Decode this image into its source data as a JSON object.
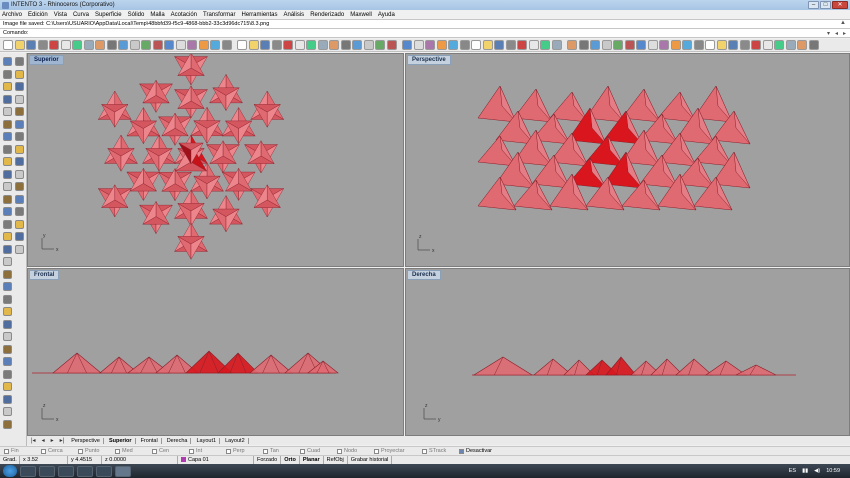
{
  "window": {
    "title": "INTENTO 3 - Rhinoceros (Corporativo)"
  },
  "menu": [
    "Archivo",
    "Edición",
    "Vista",
    "Curva",
    "Superficie",
    "Sólido",
    "Malla",
    "Acotación",
    "Transformar",
    "Herramientas",
    "Análisis",
    "Renderizado",
    "Maxwell",
    "Ayuda"
  ],
  "command_history": {
    "text": "Image file saved: C:\\Users\\USUARIO\\AppData\\Local\\Temp\\48bbfd39-f5c9-4868-bbb2-33c3d96dc715\\8.3.png"
  },
  "command_prompt": {
    "label": "Comando:"
  },
  "viewports": {
    "top": {
      "label": "Superior",
      "axis_x": "x",
      "axis_y": "y"
    },
    "perspective": {
      "label": "Perspective",
      "axis_x": "x",
      "axis_y": "y",
      "axis_z": "z"
    },
    "front": {
      "label": "Frontal",
      "axis_x": "x",
      "axis_y": "z"
    },
    "right": {
      "label": "Derecha",
      "axis_x": "y",
      "axis_y": "z"
    }
  },
  "view_tabs": [
    "Perspective",
    "Superior",
    "Frontal",
    "Derecha",
    "Layout1",
    "Layout2"
  ],
  "active_view_tab": "Superior",
  "osnaps": [
    "Fin",
    "Cerca",
    "Punto",
    "Med",
    "Cen",
    "Int",
    "Perp",
    "Tan",
    "Cuad",
    "Nodo",
    "Proyectar",
    "STrack",
    "Desactivar"
  ],
  "status": {
    "left_cell": "Grad.",
    "x": "x 3.52",
    "y": "y 4.4515",
    "z": "z 0.0000",
    "layer": "Capa 01",
    "modes": [
      "Forzado",
      "Orto",
      "Planar",
      "RefObj",
      "Grabar historial"
    ]
  },
  "tray": {
    "lang": "ES",
    "time": "10:59"
  },
  "colors": {
    "geometry": "#e06a72",
    "geometry_edge": "#8a1f2a",
    "geometry_selected": "#d9161d",
    "viewport_bg": "#a0a0a0"
  }
}
